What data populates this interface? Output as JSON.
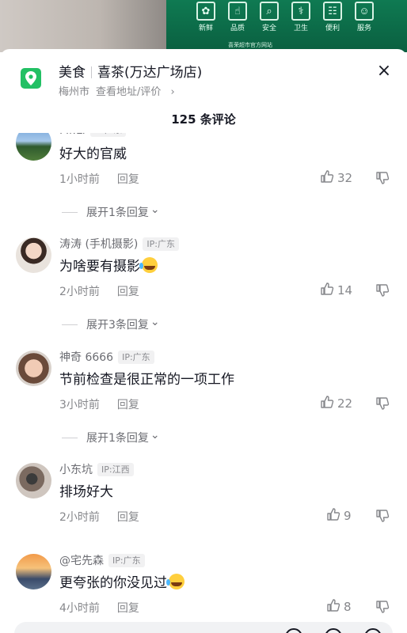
{
  "banner": {
    "sign_items": [
      {
        "icon": "grape-icon",
        "glyph": "✿",
        "label": "新鲜"
      },
      {
        "icon": "thumbs-up-icon",
        "glyph": "☝",
        "label": "品质"
      },
      {
        "icon": "magnifier-icon",
        "glyph": "⌕",
        "label": "安全"
      },
      {
        "icon": "microscope-icon",
        "glyph": "⚕",
        "label": "卫生"
      },
      {
        "icon": "cart-icon",
        "glyph": "☷",
        "label": "便利"
      },
      {
        "icon": "smile-icon",
        "glyph": "☺",
        "label": "服务"
      }
    ],
    "sign_bottom_text": "喜荣超市官方网站"
  },
  "poi": {
    "category": "美食",
    "name": "喜茶(万达广场店)",
    "city": "梅州市",
    "link": "查看地址/评价",
    "link_arrow": "›",
    "icon": "location-pin-icon",
    "accent": "#22c064"
  },
  "close": {
    "glyph": "×",
    "icon": "close-icon"
  },
  "comment_count": "125 条评论",
  "reply_label": "回复",
  "expand_arrow": "⌄",
  "comments": [
    {
      "name": "Mr.Li",
      "ip": "IP:广东",
      "text": "好大的官威",
      "emoji": false,
      "time": "1小时前",
      "likes": "32",
      "expand": "展开1条回复"
    },
    {
      "name": "涛涛 (手机摄影)",
      "ip": "IP:广东",
      "text": "为啥要有摄影",
      "emoji": true,
      "time": "2小时前",
      "likes": "14",
      "expand": "展开3条回复"
    },
    {
      "name": "神奇 6666",
      "ip": "IP:广东",
      "text": "节前检查是很正常的一项工作",
      "emoji": false,
      "time": "3小时前",
      "likes": "22",
      "expand": "展开1条回复"
    },
    {
      "name": "小东坑",
      "ip": "IP:江西",
      "text": "排场好大",
      "emoji": false,
      "time": "2小时前",
      "likes": "9",
      "expand": ""
    },
    {
      "name": "@宅先森",
      "ip": "IP:广东",
      "text": "更夸张的你没见过",
      "emoji": true,
      "time": "4小时前",
      "likes": "8",
      "expand": ""
    }
  ]
}
